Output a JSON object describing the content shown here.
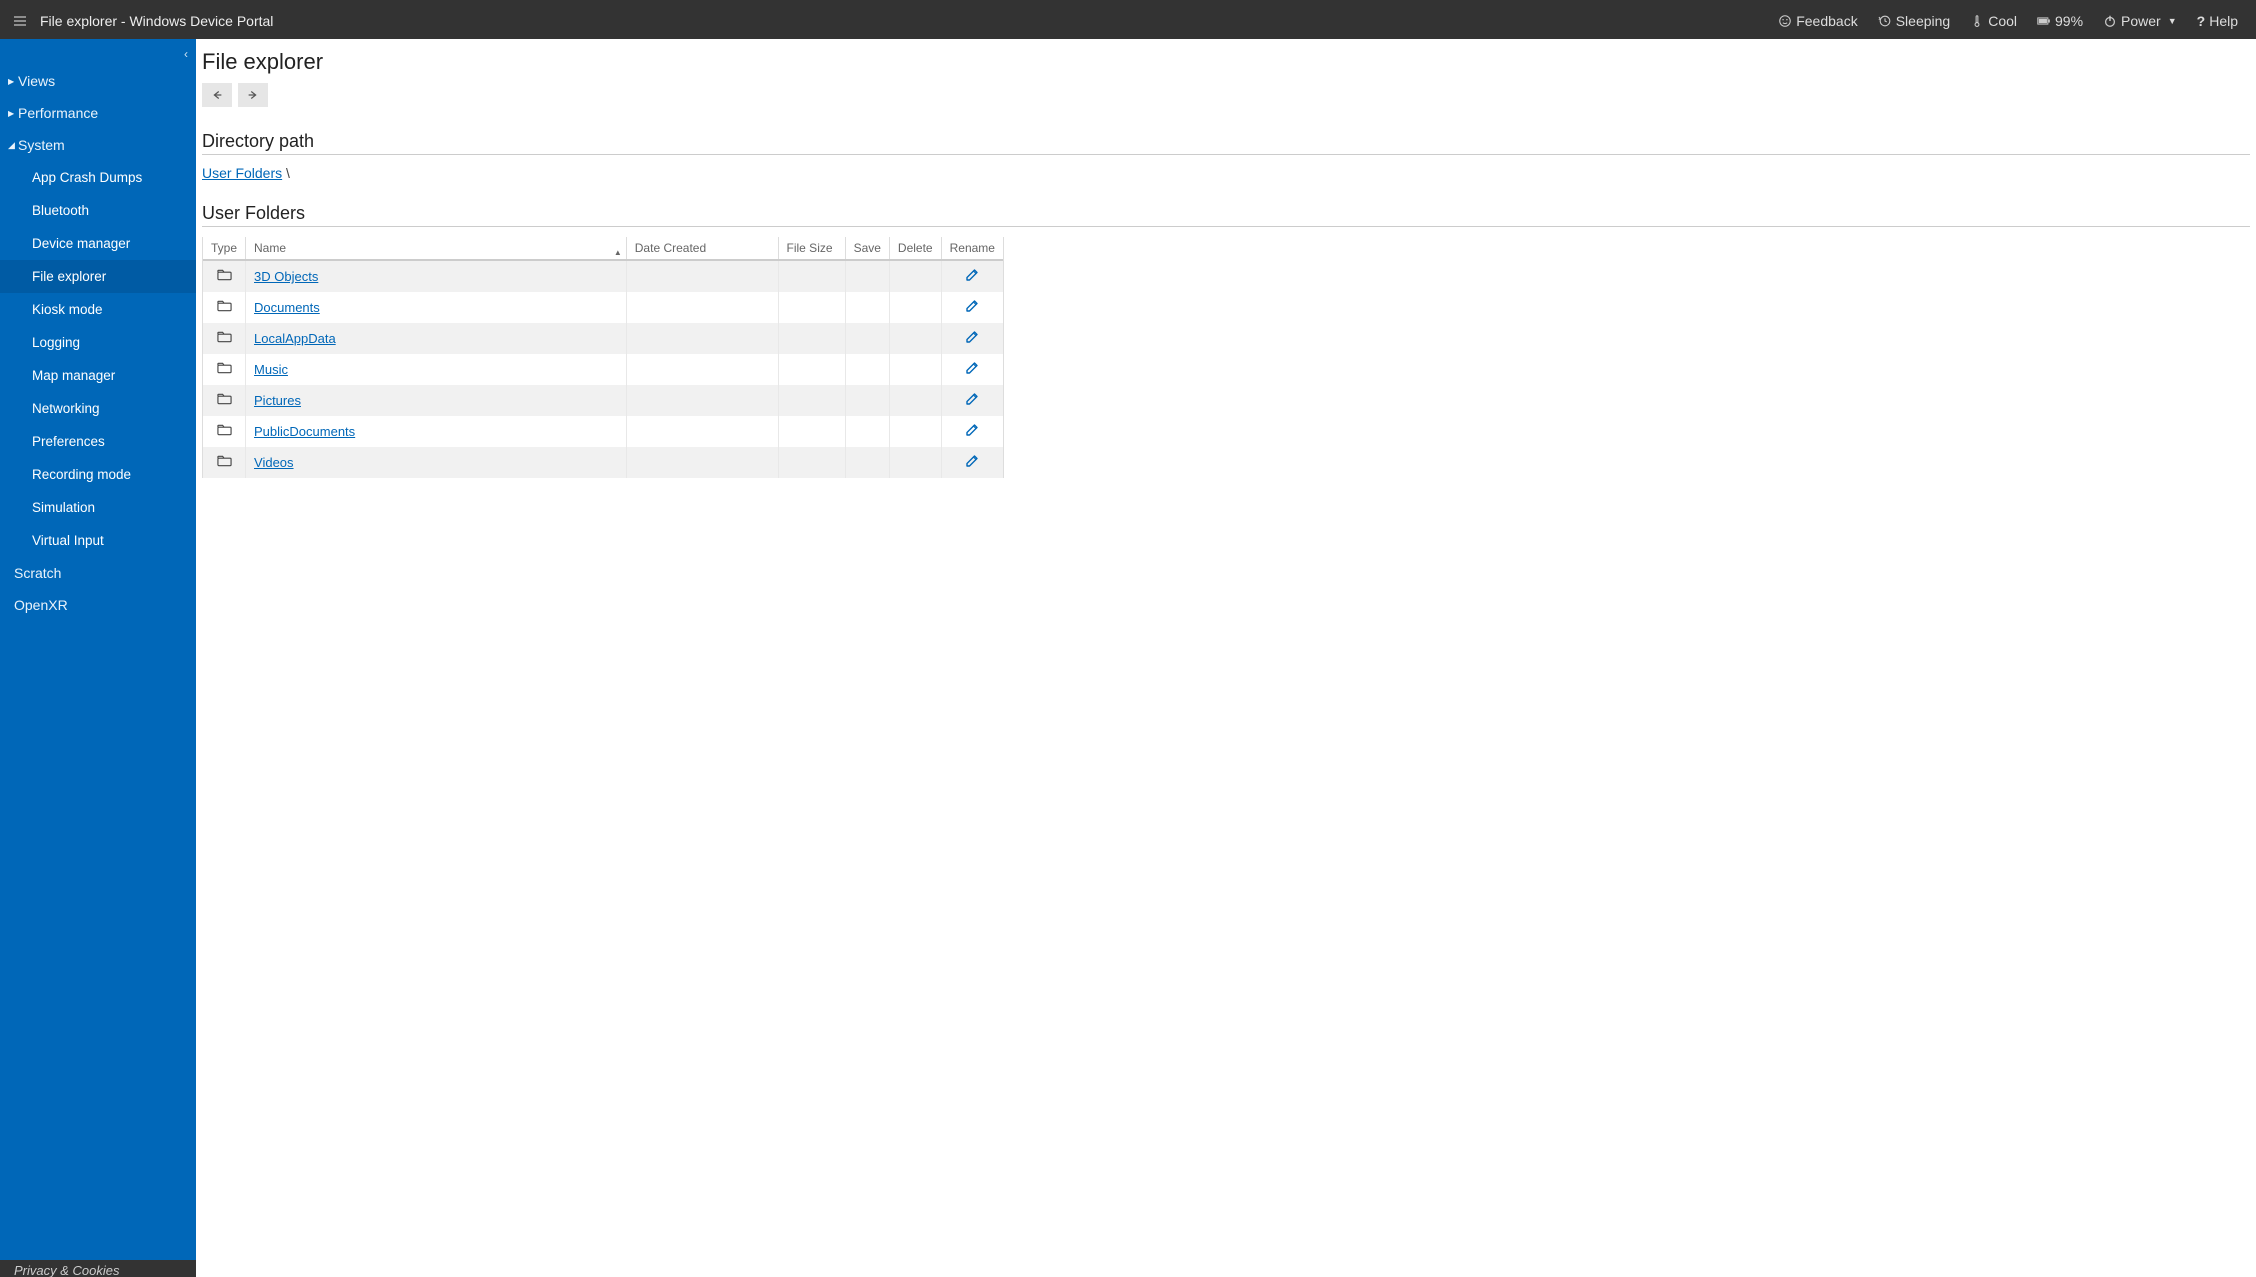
{
  "header": {
    "title": "File explorer - Windows Device Portal",
    "items": {
      "feedback": "Feedback",
      "sleeping": "Sleeping",
      "cool": "Cool",
      "battery": "99%",
      "power": "Power",
      "help": "Help"
    }
  },
  "sidebar": {
    "groups": [
      {
        "label": "Views",
        "expanded": false
      },
      {
        "label": "Performance",
        "expanded": false
      },
      {
        "label": "System",
        "expanded": true
      }
    ],
    "system_items": [
      "App Crash Dumps",
      "Bluetooth",
      "Device manager",
      "File explorer",
      "Kiosk mode",
      "Logging",
      "Map manager",
      "Networking",
      "Preferences",
      "Recording mode",
      "Simulation",
      "Virtual Input"
    ],
    "active_item": "File explorer",
    "top_items": [
      "Scratch",
      "OpenXR"
    ],
    "footer": "Privacy & Cookies"
  },
  "main": {
    "title": "File explorer",
    "dir_path_label": "Directory path",
    "breadcrumb_root": "User Folders",
    "breadcrumb_sep": "\\",
    "section_heading": "User Folders",
    "columns": {
      "type": "Type",
      "name": "Name",
      "date": "Date Created",
      "size": "File Size",
      "save": "Save",
      "delete": "Delete",
      "rename": "Rename"
    },
    "rows": [
      {
        "name": "3D Objects"
      },
      {
        "name": "Documents"
      },
      {
        "name": "LocalAppData"
      },
      {
        "name": "Music"
      },
      {
        "name": "Pictures"
      },
      {
        "name": "PublicDocuments"
      },
      {
        "name": "Videos"
      }
    ]
  }
}
